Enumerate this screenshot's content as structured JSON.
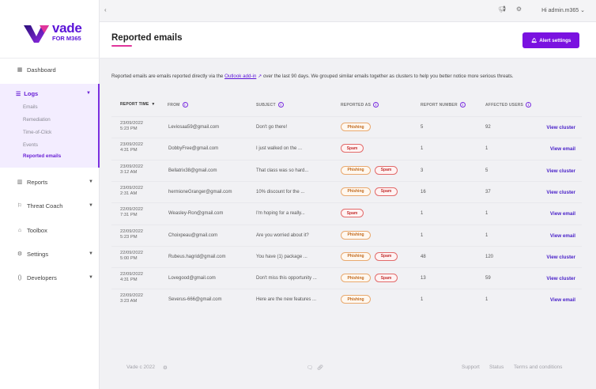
{
  "brand": {
    "name": "vade",
    "subtitle": "FOR M365",
    "color": "#5b14d8"
  },
  "topbar": {
    "collapse_icon": "chevron-left-icon",
    "greeting": "Hi admin.m365 ⌄"
  },
  "sidebar": {
    "dashboard": "Dashboard",
    "logs": "Logs",
    "logs_items": [
      "Emails",
      "Remediation",
      "Time-of-Click",
      "Events",
      "Reported emails"
    ],
    "reports": "Reports",
    "threat_coach": "Threat Coach",
    "toolbox": "Toolbox",
    "settings": "Settings",
    "developers": "Developers"
  },
  "page": {
    "title": "Reported emails",
    "alert_button": "Alert settings",
    "description_pre": "Reported emails are emails reported directly via the ",
    "description_link": "Outlook add-in",
    "description_post": " over the last 90 days.  We grouped similar emails together as clusters to help you better notice more serious threats."
  },
  "table": {
    "headers": {
      "report_time": "REPORT TIME",
      "from": "FROM",
      "subject": "SUBJECT",
      "reported_as": "REPORTED AS",
      "report_number": "REPORT NUMBER",
      "affected_users": "AFFECTED USERS"
    },
    "rows": [
      {
        "date": "23/09/2022",
        "time": "5:23 PM",
        "from": "Leviosaa59@gmail.com",
        "subject": "Don't go there!",
        "tags": [
          "Phishing"
        ],
        "reports": "5",
        "users": "92",
        "action": "View cluster"
      },
      {
        "date": "23/09/2022",
        "time": "4:31 PM",
        "from": "DobbyFree@gmail.com",
        "subject": "I just walked on the ...",
        "tags": [
          "Spam"
        ],
        "reports": "1",
        "users": "1",
        "action": "View email"
      },
      {
        "date": "23/09/2022",
        "time": "3:12 AM",
        "from": "Bellatrix38@gmail.com",
        "subject": "That class was so hard...",
        "tags": [
          "Phishing",
          "Spam"
        ],
        "reports": "3",
        "users": "5",
        "action": "View cluster"
      },
      {
        "date": "23/09/2022",
        "time": "2:31 AM",
        "from": "hermioneGranger@gmail.com",
        "subject": "10% discount for the ...",
        "tags": [
          "Phishing",
          "Spam"
        ],
        "reports": "16",
        "users": "37",
        "action": "View cluster"
      },
      {
        "date": "22/09/2022",
        "time": "7:31 PM",
        "from": "Weasley-Ron@gmail.com",
        "subject": "I'm hoping for a really...",
        "tags": [
          "Spam"
        ],
        "reports": "1",
        "users": "1",
        "action": "View email"
      },
      {
        "date": "22/09/2022",
        "time": "5:23 PM",
        "from": "Choixpeau@gmail.com",
        "subject": "Are you worried about it?",
        "tags": [
          "Phishing"
        ],
        "reports": "1",
        "users": "1",
        "action": "View email"
      },
      {
        "date": "22/09/2022",
        "time": "5:00 PM",
        "from": "Rubeus.hagrid@gmail.com",
        "subject": "You have (1) package ...",
        "tags": [
          "Phishing",
          "Spam"
        ],
        "reports": "48",
        "users": "120",
        "action": "View cluster"
      },
      {
        "date": "22/09/2022",
        "time": "4:31 PM",
        "from": "Lovegood@gmail.com",
        "subject": "Don't miss this opportunity ...",
        "tags": [
          "Phishing",
          "Spam"
        ],
        "reports": "13",
        "users": "59",
        "action": "View cluster"
      },
      {
        "date": "22/09/2022",
        "time": "3:23 AM",
        "from": "Severus-666@gmail.com",
        "subject": "Here are the new features ...",
        "tags": [
          "Phishing"
        ],
        "reports": "1",
        "users": "1",
        "action": "View email"
      }
    ]
  },
  "footer": {
    "copyright": "Vade c 2022",
    "support": "Support",
    "status": "Status",
    "terms": "Terms and conditions"
  }
}
